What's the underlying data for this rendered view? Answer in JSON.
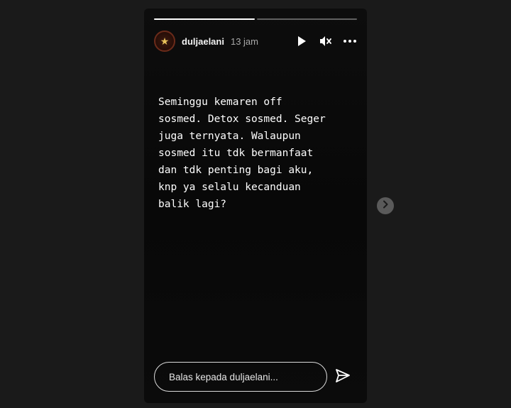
{
  "story": {
    "username": "duljaelani",
    "time": "13 jam",
    "avatar_icon": "star-emblem",
    "progress": [
      1.0,
      0.0
    ],
    "text": "Seminggu kemaren off\nsosmed. Detox sosmed. Seger\njuga ternyata. Walaupun\nsosmed itu tdk bermanfaat\ndan tdk penting bagi aku,\nknp ya selalu kecanduan\nbalik lagi?"
  },
  "reply": {
    "placeholder": "Balas kepada duljaelani..."
  },
  "icons": {
    "play": "play-icon",
    "mute": "mute-icon",
    "more": "more-icon",
    "send": "send-icon",
    "next": "chevron-right-icon"
  },
  "colors": {
    "background": "#1a1a1a",
    "story_background": "#0b0b0b",
    "text": "#ffffff",
    "muted_text": "#a8a8a8"
  }
}
